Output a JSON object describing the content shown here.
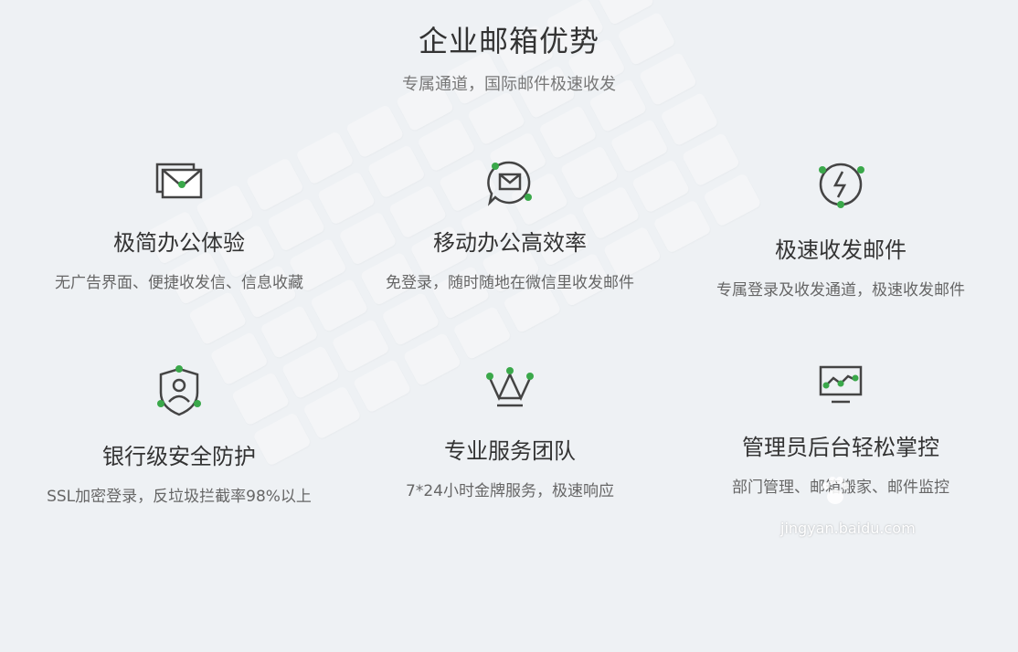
{
  "header": {
    "title": "企业邮箱优势",
    "subtitle": "专属通道，国际邮件极速收发"
  },
  "features": [
    {
      "name": "极简办公体验",
      "desc": "无广告界面、便捷收发信、信息收藏",
      "icon": "envelope-icon"
    },
    {
      "name": "移动办公高效率",
      "desc": "免登录，随时随地在微信里收发邮件",
      "icon": "chat-mail-icon"
    },
    {
      "name": "极速收发邮件",
      "desc": "专属登录及收发通道，极速收发邮件",
      "icon": "lightning-icon"
    },
    {
      "name": "银行级安全防护",
      "desc": "SSL加密登录，反垃圾拦截率98%以上",
      "icon": "shield-user-icon"
    },
    {
      "name": "专业服务团队",
      "desc": "7*24小时金牌服务，极速响应",
      "icon": "crown-icon"
    },
    {
      "name": "管理员后台轻松掌控",
      "desc": "部门管理、邮箱搬家、邮件监控",
      "icon": "monitor-chart-icon"
    }
  ],
  "watermark": {
    "text": "jingyan.baidu.com",
    "brand": "Bai 经验"
  },
  "colors": {
    "accent": "#3aa84a",
    "icon_stroke": "#444444"
  }
}
